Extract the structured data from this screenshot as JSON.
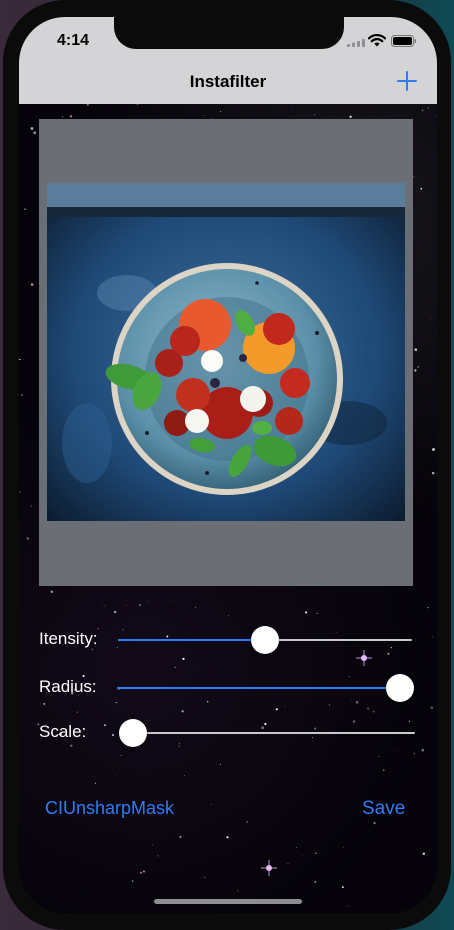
{
  "status_bar": {
    "time": "4:14"
  },
  "nav_bar": {
    "title": "Instafilter",
    "add_icon": "plus-icon"
  },
  "sliders": [
    {
      "label": "Itensity:",
      "value": 0.5
    },
    {
      "label": "Radius:",
      "value": 1.0
    },
    {
      "label": "Scale:",
      "value": 0.0
    }
  ],
  "footer": {
    "filter_button": "CIUnsharpMask",
    "save_button": "Save"
  },
  "colors": {
    "accent": "#2f7df6",
    "nav_background": "#d4d4d6",
    "image_placeholder": "#6c6e76"
  }
}
